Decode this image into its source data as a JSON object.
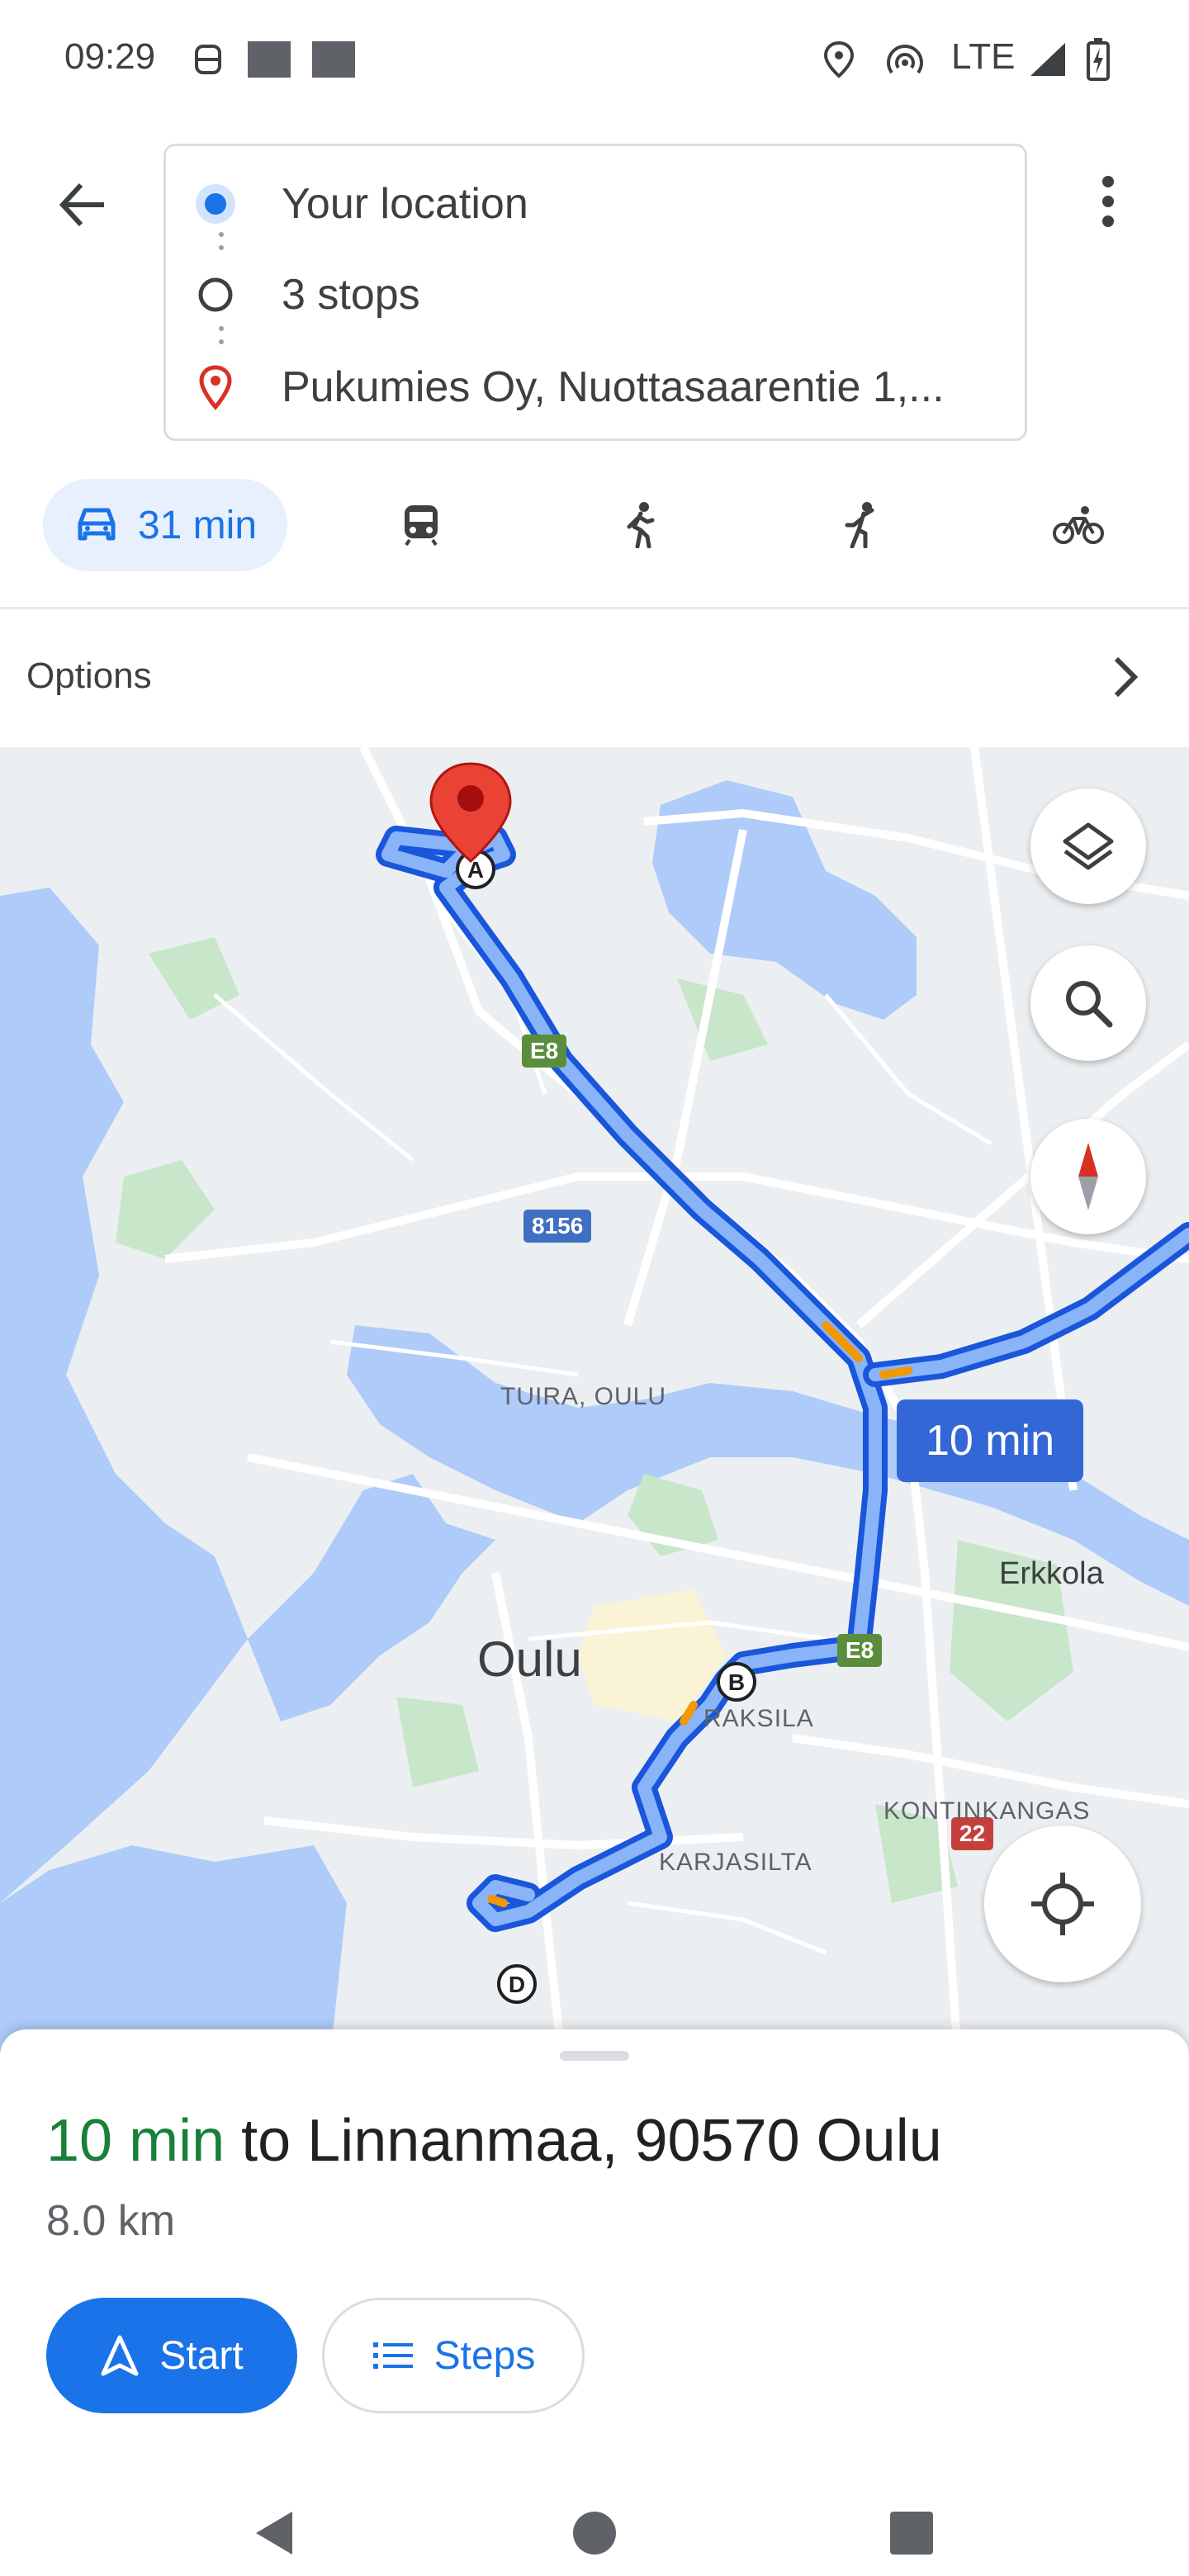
{
  "status_bar": {
    "time": "09:29",
    "network": "LTE"
  },
  "directions": {
    "origin": "Your location",
    "stops": "3 stops",
    "destination": "Pukumies Oy, Nuottasaarentie 1,..."
  },
  "modes": [
    {
      "name": "driving",
      "icon": "car-icon",
      "time": "31 min",
      "active": true
    },
    {
      "name": "transit",
      "icon": "train-icon"
    },
    {
      "name": "walking",
      "icon": "walk-icon"
    },
    {
      "name": "ride",
      "icon": "rideshare-icon"
    },
    {
      "name": "cycling",
      "icon": "bicycle-icon"
    }
  ],
  "options": {
    "label": "Options"
  },
  "map": {
    "route_time": "10 min",
    "labels": {
      "tuira": "TUIRA, OULU",
      "city": "Oulu",
      "erkkola": "Erkkola",
      "raksila": "RAKSILA",
      "kontinkangas": "KONTINKANGAS",
      "karjasilta": "KARJASILTA"
    },
    "shields": {
      "e8_top": "E8",
      "e8_bottom": "E8",
      "r8156": "8156",
      "r22": "22"
    },
    "waypoints": [
      "A",
      "B",
      "D"
    ],
    "colors": {
      "route": "#4285f4",
      "route_outline": "#1a56db",
      "water": "#aecbfa",
      "park": "#c8e6c9"
    }
  },
  "sheet": {
    "time": "10 min",
    "destination_text": " to Linnanmaa, 90570 Oulu",
    "distance": "8.0 km",
    "start_label": "Start",
    "steps_label": "Steps"
  }
}
